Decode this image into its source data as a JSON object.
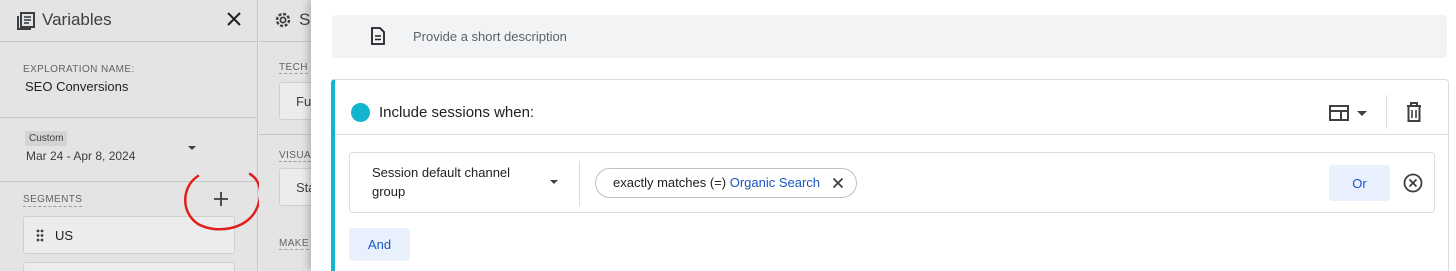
{
  "variables_panel": {
    "title": "Variables",
    "exploration_name_label": "EXPLORATION NAME:",
    "exploration_name": "SEO Conversions",
    "date_preset": "Custom",
    "date_range": "Mar 24 - Apr 8, 2024",
    "segments_label": "SEGMENTS",
    "segments": [
      {
        "name": "US"
      }
    ]
  },
  "settings_panel": {
    "title": "Se",
    "technique_label": "TECH",
    "technique_value": "Fu",
    "visualization_label": "VISUA",
    "visualization_value": "Sta",
    "make_label": "MAKE"
  },
  "segment_builder": {
    "description_placeholder": "Provide a short description",
    "condition_header": "Include sessions when:",
    "condition": {
      "dimension": "Session default channel group",
      "operator": "exactly matches (=)",
      "value": "Organic Search"
    },
    "or_label": "Or",
    "and_label": "And"
  },
  "colors": {
    "accent_teal": "#12b5cb",
    "link_blue": "#1a56c4",
    "button_tint": "#e8f0fe",
    "annotation_red": "#e0201c"
  },
  "icons": [
    "variables-list-icon",
    "close-icon",
    "gear-icon",
    "document-icon",
    "layout-icon",
    "chevron-down-icon",
    "trash-icon",
    "remove-circle-icon",
    "plus-icon",
    "drag-handle-icon"
  ]
}
